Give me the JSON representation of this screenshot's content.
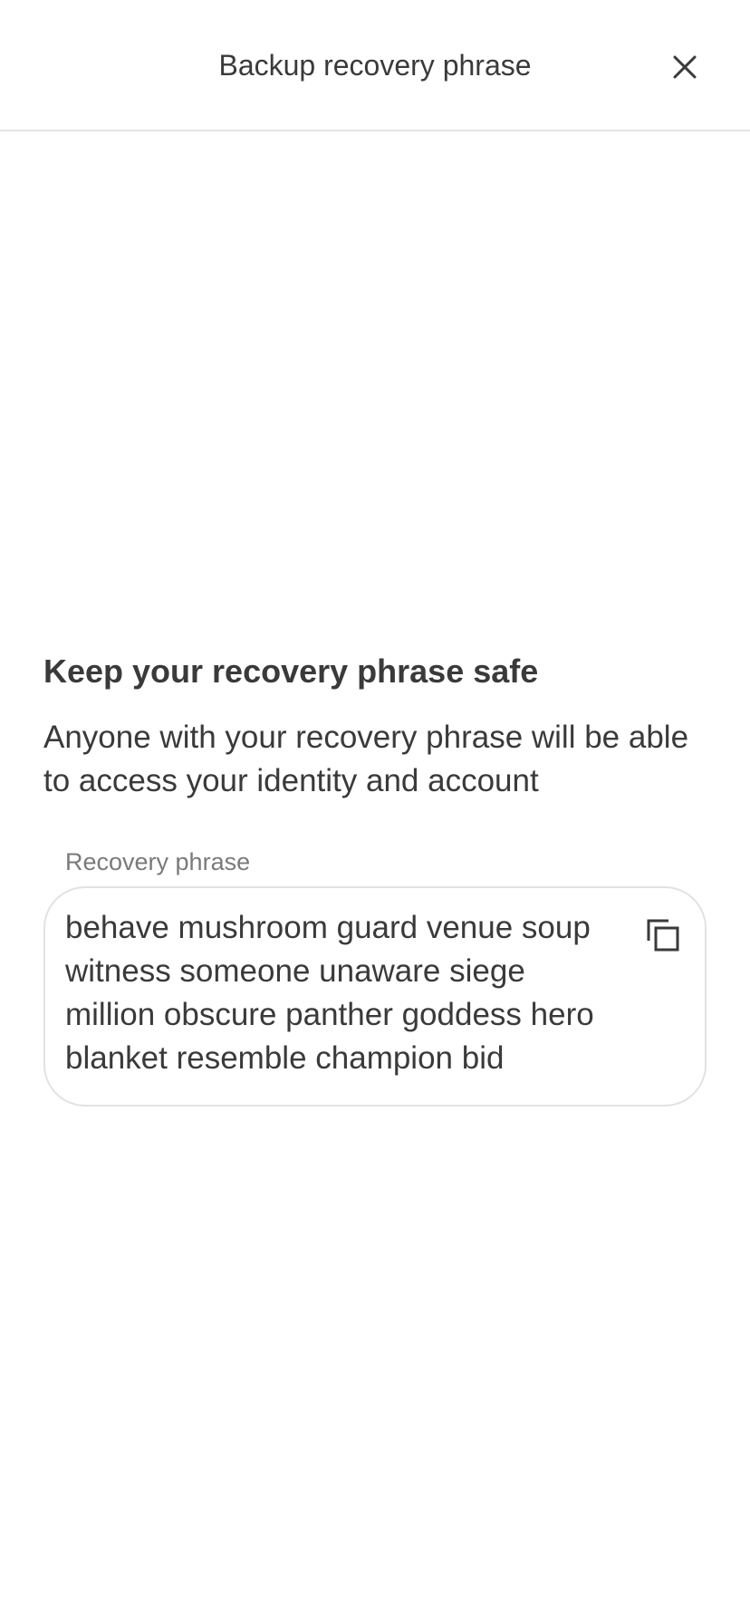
{
  "header": {
    "title": "Backup recovery phrase",
    "close_icon": "close-icon"
  },
  "main": {
    "title": "Keep your recovery phrase safe",
    "description": "Anyone with your recovery phrase will be able to access your identity and account",
    "phrase_field": {
      "label": "Recovery phrase",
      "value": "behave mushroom guard venue soup witness someone unaware siege million obscure panther goddess hero blanket resemble champion bid",
      "copy_icon": "copy-icon"
    }
  },
  "colors": {
    "text": "#3a3a3a",
    "muted": "#7a7a7a",
    "border": "#e2e2e2",
    "background": "#ffffff"
  }
}
